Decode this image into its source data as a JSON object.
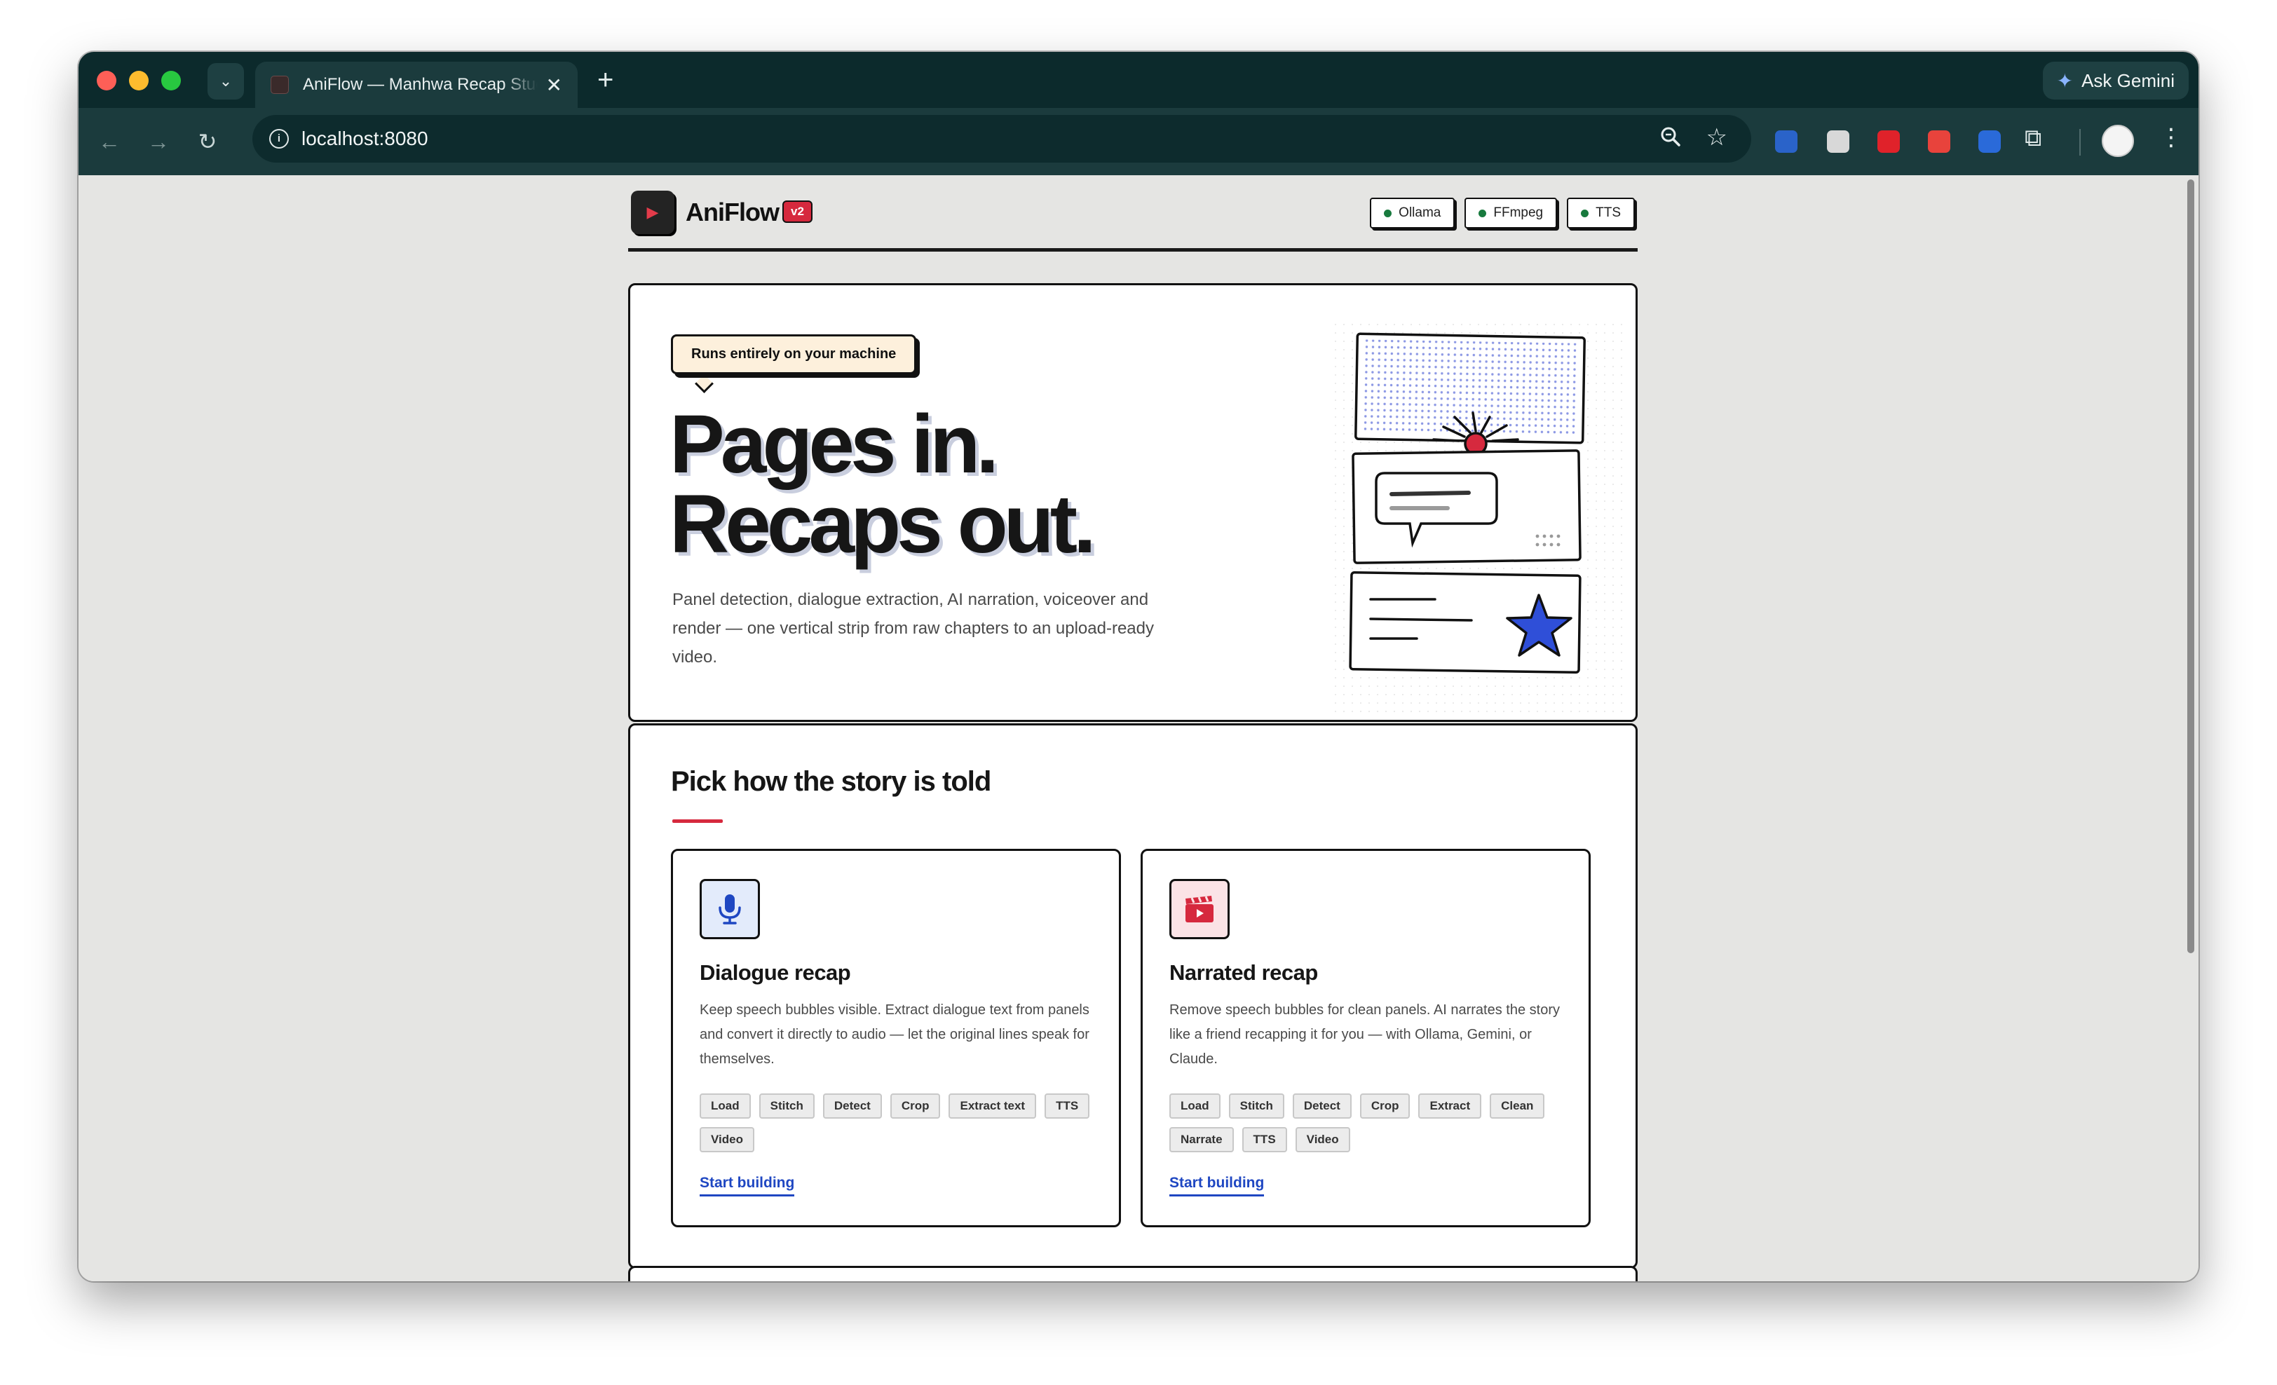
{
  "browser": {
    "tab_title": "AniFlow — Manhwa Recap Studio",
    "tab_close": "✕",
    "new_tab": "+",
    "ask_gemini": "Ask Gemini",
    "url": "localhost:8080",
    "icons": [
      "tab-search-icon",
      "back-arrow-icon",
      "forward-arrow-icon",
      "reload-icon",
      "info-icon",
      "zoom-icon",
      "bookmark-star-icon",
      "extensions-puzzle-icon",
      "profile-avatar",
      "more-menu-icon"
    ]
  },
  "app": {
    "brand": "AniFlow",
    "version": "v2",
    "status": [
      {
        "label": "Ollama",
        "color": "#187a3e"
      },
      {
        "label": "FFmpeg",
        "color": "#187a3e"
      },
      {
        "label": "TTS",
        "color": "#187a3e"
      }
    ]
  },
  "hero": {
    "tag": "Runs entirely on your machine",
    "title_line1": "Pages in.",
    "title_line2": "Recaps out.",
    "description": "Panel detection, dialogue extraction, AI narration, voiceover and render — one vertical strip from raw chapters to an upload-ready video."
  },
  "modes": {
    "section_title": "Pick how the story is told",
    "cards": [
      {
        "title": "Dialogue recap",
        "icon": "microphone-icon",
        "description": "Keep speech bubbles visible. Extract dialogue text from panels and convert it directly to audio — let the original lines speak for themselves.",
        "steps": [
          "Load",
          "Stitch",
          "Detect",
          "Crop",
          "Extract text",
          "TTS",
          "Video"
        ],
        "cta": "Start building"
      },
      {
        "title": "Narrated recap",
        "icon": "video-clapper-icon",
        "description": "Remove speech bubbles for clean panels. AI narrates the story like a friend recapping it for you — with Ollama, Gemini, or Claude.",
        "steps": [
          "Load",
          "Stitch",
          "Detect",
          "Crop",
          "Extract",
          "Clean",
          "Narrate",
          "TTS",
          "Video"
        ],
        "cta": "Start building"
      }
    ]
  },
  "colors": {
    "accent_red": "#d6293e",
    "link_blue": "#1f47c2",
    "chrome_dark": "#0c2a2c",
    "star_blue": "#2f4fd8"
  }
}
